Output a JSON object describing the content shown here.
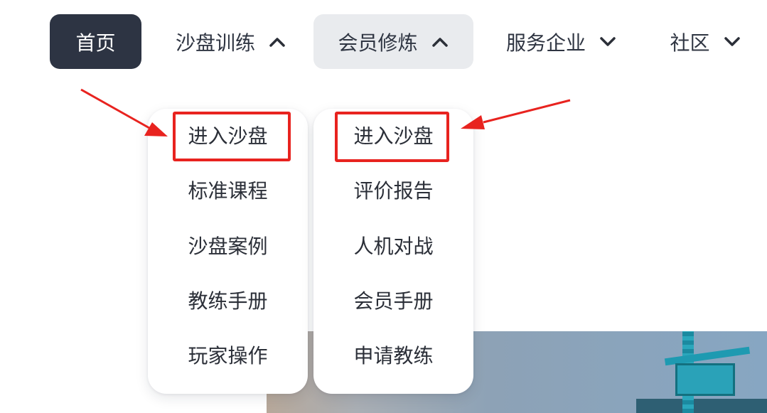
{
  "nav": {
    "home": "首页",
    "sandbox": "沙盘训练",
    "member": "会员修炼",
    "enterprise": "服务企业",
    "community": "社区"
  },
  "dropdowns": {
    "sandbox": {
      "items": [
        {
          "label": "进入沙盘"
        },
        {
          "label": "标准课程"
        },
        {
          "label": "沙盘案例"
        },
        {
          "label": "教练手册"
        },
        {
          "label": "玩家操作"
        }
      ]
    },
    "member": {
      "items": [
        {
          "label": "进入沙盘"
        },
        {
          "label": "评价报告"
        },
        {
          "label": "人机对战"
        },
        {
          "label": "会员手册"
        },
        {
          "label": "申请教练"
        }
      ]
    }
  },
  "colors": {
    "home_active_bg": "#2d3443",
    "member_open_bg": "#e9ebee",
    "annotation_red": "#e8231f",
    "text": "#2f3542"
  },
  "icons": {
    "sandbox_chevron": "chevron-up-icon",
    "member_chevron": "chevron-up-icon",
    "enterprise_chevron": "chevron-down-icon",
    "community_chevron": "chevron-down-icon"
  }
}
